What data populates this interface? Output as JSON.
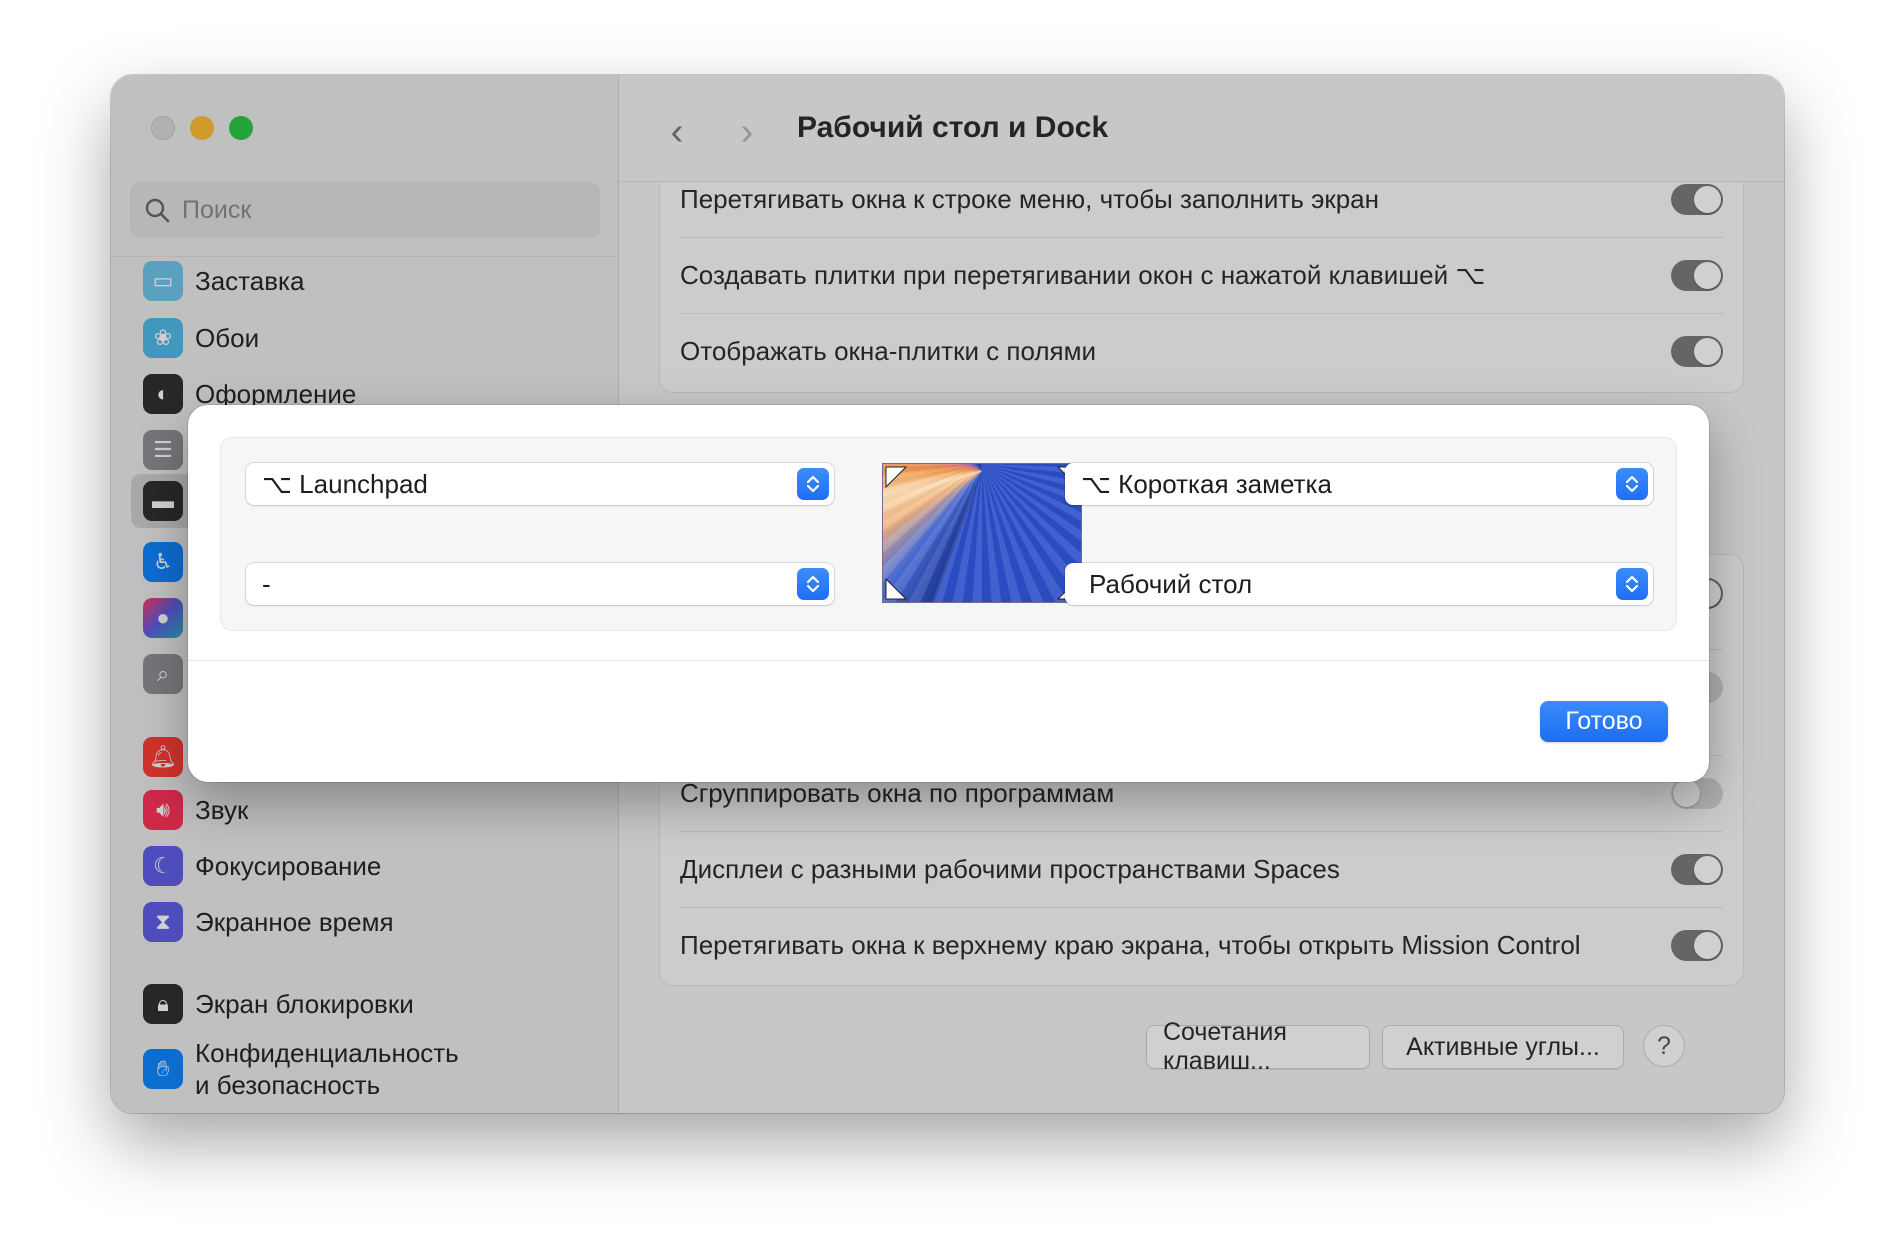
{
  "window": {
    "title": "Рабочий стол и Dock"
  },
  "search": {
    "placeholder": "Поиск"
  },
  "sidebar": {
    "items": [
      {
        "label": "Заставка",
        "icon": "screensaver-icon",
        "color": "#5ac8fa"
      },
      {
        "label": "Обои",
        "icon": "wallpaper-icon",
        "color": "#35b5e8"
      },
      {
        "label": "Оформление",
        "icon": "appearance-icon",
        "color": "#1c1c1e"
      },
      {
        "label": "",
        "icon": "control-center-icon",
        "color": "#8e8e93"
      },
      {
        "label": "",
        "icon": "desktop-dock-icon",
        "color": "#1c1c1e"
      },
      {
        "label": "",
        "icon": "accessibility-icon",
        "color": "#0a84ff"
      },
      {
        "label": "",
        "icon": "siri-icon",
        "color": "#b04fd8"
      },
      {
        "label": "",
        "icon": "spotlight-icon",
        "color": "#8e8e93"
      },
      {
        "label": "",
        "icon": "notifications-icon",
        "color": "#ff3b30"
      },
      {
        "label": "Звук",
        "icon": "sound-icon",
        "color": "#ff2d55"
      },
      {
        "label": "Фокусирование",
        "icon": "focus-icon",
        "color": "#5e5ce6"
      },
      {
        "label": "Экранное время",
        "icon": "screen-time-icon",
        "color": "#5e5ce6"
      },
      {
        "label": "Экран блокировки",
        "icon": "lock-screen-icon",
        "color": "#1c1c1e"
      },
      {
        "label": "Конфиденциальность",
        "label2": "и безопасность",
        "icon": "privacy-hand-icon",
        "color": "#0a84ff"
      }
    ]
  },
  "settings": {
    "top_rows": [
      {
        "label": "Перетягивать окна к строке меню, чтобы заполнить экран",
        "on": true
      },
      {
        "label": "Создавать плитки при перетягивании окон с нажатой клавишей ⌥",
        "on": true
      },
      {
        "label": "Отображать окна-плитки с полями",
        "on": true
      }
    ],
    "bottom_rows": [
      {
        "label": "Сгруппировать окна по программам",
        "on": false
      },
      {
        "label": "Дисплеи с разными рабочими пространствами Spaces",
        "on": true
      },
      {
        "label": "Перетягивать окна к верхнему краю экрана, чтобы открыть Mission Control",
        "on": true
      }
    ],
    "buttons": {
      "shortcuts": "Сочетания клавиш...",
      "hot_corners": "Активные углы...",
      "help": "?"
    }
  },
  "hot_corners_sheet": {
    "top_left": "⌥ Launchpad",
    "top_right": "⌥ Короткая заметка",
    "bottom_left": "-",
    "bottom_right": "Рабочий стол",
    "done": "Готово"
  },
  "colors": {
    "accent": "#1f6ef5",
    "traffic_min": "#febc2e",
    "traffic_max": "#28c840"
  }
}
